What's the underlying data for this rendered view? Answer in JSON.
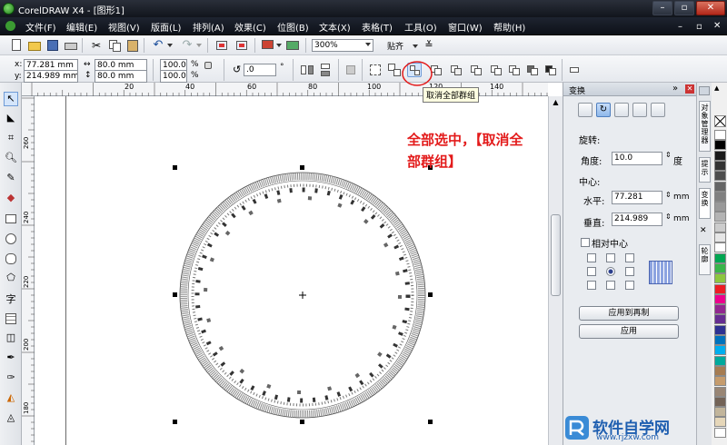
{
  "app": {
    "title": "CorelDRAW X4 - [图形1]",
    "window_buttons": [
      "minimize",
      "restore",
      "close"
    ]
  },
  "menu": {
    "items": [
      "文件(F)",
      "编辑(E)",
      "视图(V)",
      "版面(L)",
      "排列(A)",
      "效果(C)",
      "位图(B)",
      "文本(X)",
      "表格(T)",
      "工具(O)",
      "窗口(W)",
      "帮助(H)"
    ]
  },
  "standard_toolbar": {
    "zoom_value": "300%",
    "snap_label": "贴齐"
  },
  "property_bar": {
    "x_label": "x:",
    "x_value": "77.281 mm",
    "y_label": "y:",
    "y_value": "214.989 mm",
    "width_value": "80.0 mm",
    "height_value": "80.0 mm",
    "scale_x": "100.0",
    "scale_y": "100.0",
    "percent": "%",
    "rotation_value": ".0",
    "degree": "°"
  },
  "rulers": {
    "top_ticks": [
      "20",
      "40",
      "60",
      "80",
      "100",
      "120",
      "140"
    ],
    "left_ticks": [
      "260",
      "240",
      "220",
      "200",
      "180"
    ]
  },
  "tooltip": {
    "text": "取消全部群组"
  },
  "annotation": {
    "line1": "全部选中，【取消全",
    "line2": "部群组】",
    "color": "#e31b1b"
  },
  "docker": {
    "title": "变换",
    "section_rotate": "旋转:",
    "angle_label": "角度:",
    "angle_value": "10.0",
    "angle_unit": "度",
    "center_label": "中心:",
    "h_label": "水平:",
    "h_value": "77.281",
    "h_unit": "mm",
    "v_label": "垂直:",
    "v_value": "214.989",
    "v_unit": "mm",
    "relative_center": "相对中心",
    "apply_copy_button": "应用到再制",
    "apply_button": "应用"
  },
  "side_tabs": [
    "对象管理器",
    "提示",
    "变换",
    "轮廓"
  ],
  "palette_colors": [
    "#ffffff",
    "#000000",
    "#1a1a1a",
    "#333333",
    "#4d4d4d",
    "#666666",
    "#808080",
    "#999999",
    "#b3b3b3",
    "#cccccc",
    "#e6e6e6",
    "#ffffff",
    "#00a651",
    "#39b54a",
    "#8dc63f",
    "#ed1c24",
    "#ec008c",
    "#92278f",
    "#662d91",
    "#2e3192",
    "#0072bc",
    "#00aeef",
    "#00a99d",
    "#a67c52",
    "#c69c6d",
    "#998675",
    "#736357",
    "#c2b59b",
    "#e6d7b9",
    "#ffffff"
  ],
  "watermark": {
    "brand": "软件自学网",
    "url": "www.rjzxw.com"
  }
}
